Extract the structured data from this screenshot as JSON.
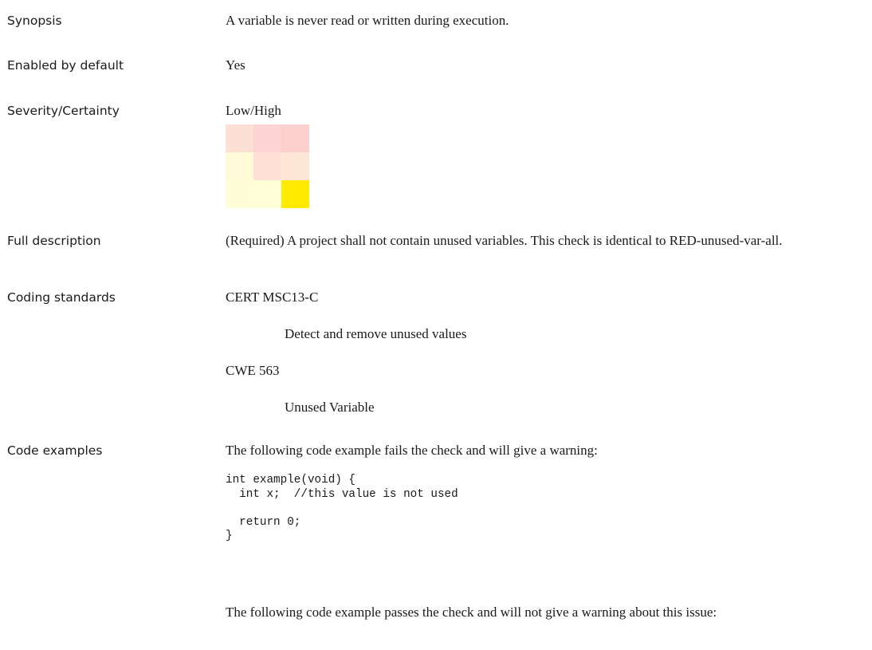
{
  "rows": {
    "synopsis": {
      "label": "Synopsis",
      "value": "A variable is never read or written during execution."
    },
    "enabled": {
      "label": "Enabled by default",
      "value": "Yes"
    },
    "severity": {
      "label": "Severity/Certainty",
      "value": "Low/High",
      "matrix_colors": [
        [
          "#fde0d4",
          "#fdd3d3",
          "#fdd0d0"
        ],
        [
          "#fffad8",
          "#fde1d6",
          "#fde6d6"
        ],
        [
          "#fffcd8",
          "#fffed8",
          "#ffea00"
        ]
      ]
    },
    "full_description": {
      "label": "Full description",
      "value": " (Required) A project shall not contain unused variables. This check is identical to RED-unused-var-all."
    },
    "coding_standards": {
      "label": "Coding standards",
      "items": [
        {
          "name": "CERT MSC13-C",
          "description": "Detect and remove unused values"
        },
        {
          "name": "CWE 563",
          "description": "Unused Variable"
        }
      ]
    },
    "code_examples": {
      "label": "Code examples",
      "fail_intro": "The following code example fails the check and will give a warning:",
      "fail_code": "int example(void) {\n  int x;  //this value is not used\n\n  return 0;\n}",
      "pass_intro": "The following code example passes the check and will not give a warning about this issue:"
    }
  }
}
